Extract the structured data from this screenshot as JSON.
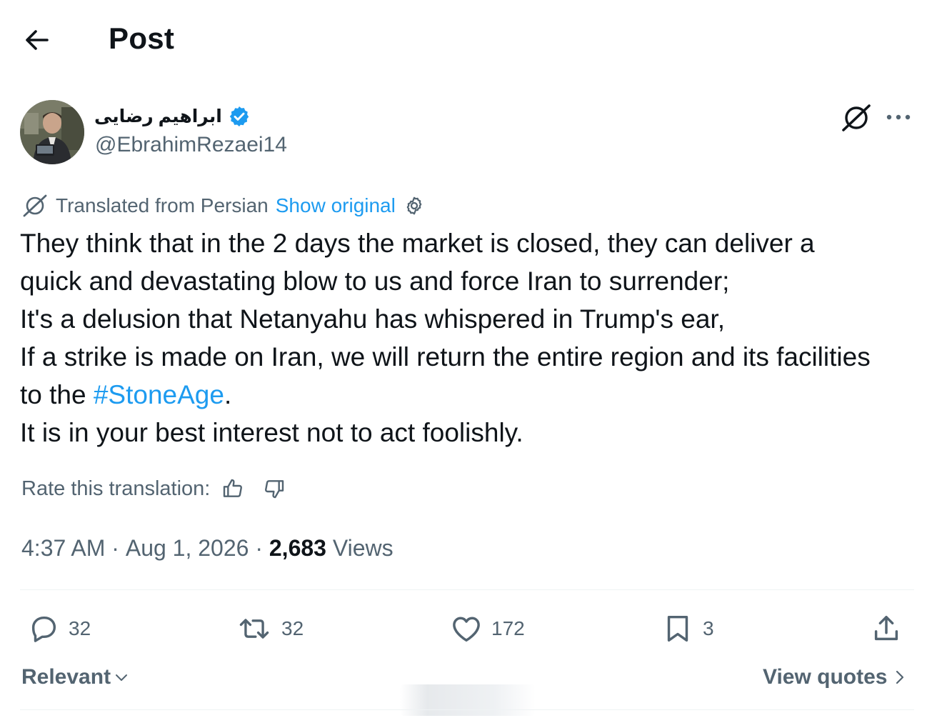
{
  "header": {
    "title": "Post"
  },
  "author": {
    "display_name": "ابراهیم رضایی",
    "handle": "@EbrahimRezaei14",
    "verified": true
  },
  "translation": {
    "label": "Translated from Persian",
    "show_original": "Show original"
  },
  "post": {
    "lines": [
      "They think that in the 2 days the market is closed, they can deliver a",
      "quick and devastating blow to us and force Iran to surrender;",
      "It's a delusion that Netanyahu has whispered in Trump's ear,",
      "If a strike is made on Iran, we will return the entire region and its facilities",
      "to the ",
      "It is in your best interest not to act foolishly."
    ],
    "hashtag": "#StoneAge",
    "after_hashtag": "."
  },
  "rating": {
    "label": "Rate this translation:"
  },
  "meta": {
    "time": "4:37 AM",
    "separator": " · ",
    "date": "Aug 1, 2026",
    "views_count": "2,683",
    "views_label": " Views"
  },
  "actions": {
    "replies": "32",
    "reposts": "32",
    "likes": "172",
    "bookmarks": "3"
  },
  "footer": {
    "sort_label": "Relevant",
    "view_quotes": "View quotes"
  },
  "colors": {
    "text": "#0f1419",
    "secondary": "#536471",
    "accent": "#1d9bf0",
    "divider": "#eff3f4"
  }
}
